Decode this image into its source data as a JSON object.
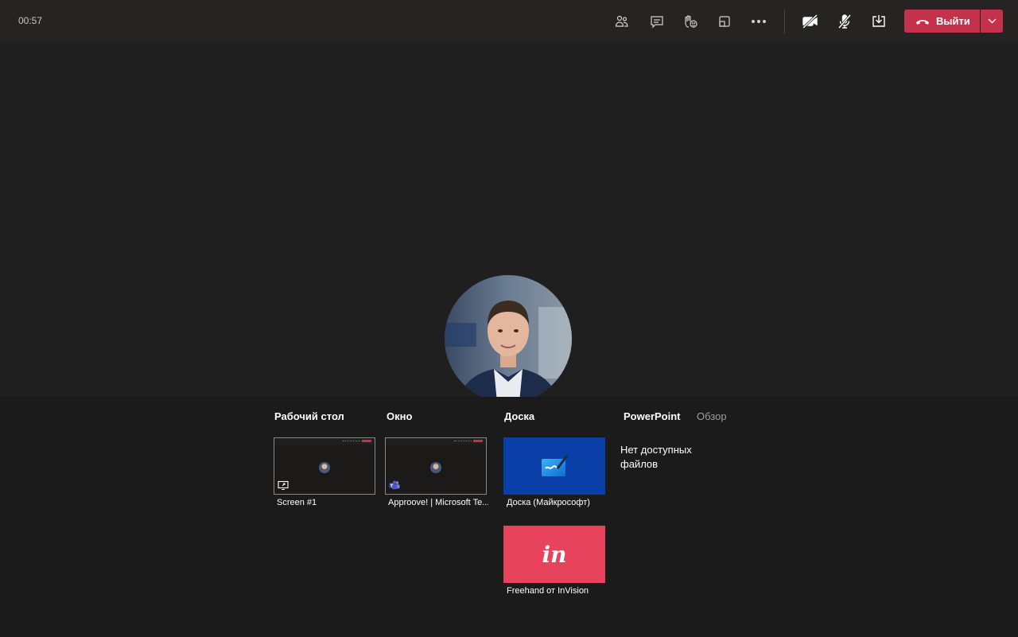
{
  "header": {
    "timer": "00:57",
    "leave_label": "Выйти",
    "icons": [
      "participants-icon",
      "chat-icon",
      "raise-hand-icon",
      "rooms-icon",
      "more-icon",
      "camera-off-icon",
      "mic-off-icon",
      "share-tray-icon",
      "phone-hangup-icon",
      "chevron-down-icon"
    ]
  },
  "tray": {
    "desktop": {
      "heading": "Рабочий стол",
      "items": [
        {
          "caption": "Screen #1"
        }
      ]
    },
    "window": {
      "heading": "Окно",
      "items": [
        {
          "caption": "Approove! | Microsoft Te..."
        }
      ]
    },
    "whiteboard": {
      "heading": "Доска",
      "items": [
        {
          "caption": "Доска (Майкрософт)"
        },
        {
          "caption": "Freehand от InVision",
          "logo_text": "in"
        }
      ]
    },
    "powerpoint": {
      "heading": "PowerPoint",
      "browse_label": "Обзор",
      "empty_text": "Нет доступных файлов"
    }
  },
  "colors": {
    "leave": "#c4314b",
    "whiteboard_tile": "#0a3fa8",
    "invision_tile": "#e8435d"
  }
}
